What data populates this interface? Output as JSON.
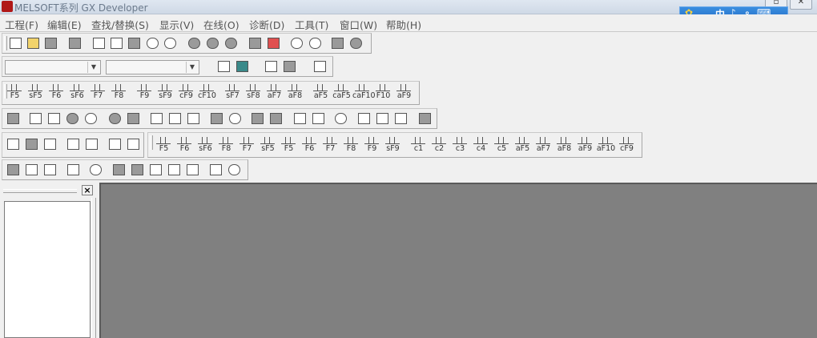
{
  "window": {
    "title": "MELSOFT系列 GX Developer"
  },
  "menu": [
    "工程(F)",
    "编辑(E)",
    "查找/替换(S)",
    "显示(V)",
    "在线(O)",
    "诊断(D)",
    "工具(T)",
    "窗口(W)",
    "帮助(H)"
  ],
  "ime": {
    "glyphs": [
      "中",
      "♪",
      "∘",
      "⌨"
    ]
  },
  "toolbar_standard": {
    "icons": [
      "new-icon",
      "open-icon",
      "save-icon",
      "print-icon",
      "cut-icon",
      "copy-icon",
      "paste-icon",
      "undo-icon",
      "redo-icon",
      "find-device-icon",
      "find-instruction-icon",
      "find-step-icon",
      "write-plc-icon",
      "read-plc-icon",
      "monitor-start-icon",
      "monitor-stop-icon",
      "parameter-icon",
      "comment-icon"
    ]
  },
  "toolbar_ladder_keys": [
    "F5",
    "sF5",
    "F6",
    "sF6",
    "F7",
    "F8",
    "F9",
    "sF9",
    "cF9",
    "cF10",
    "sF7",
    "sF8",
    "aF7",
    "aF8",
    "aF5",
    "caF5",
    "caF10",
    "F10",
    "aF9"
  ],
  "toolbar_sfc_keys": [
    "F5",
    "F6",
    "sF6",
    "F8",
    "F7",
    "sF5",
    "F5",
    "F6",
    "F7",
    "F8",
    "F9",
    "sF9",
    "c1",
    "c2",
    "c3",
    "c4",
    "c5",
    "aF5",
    "aF7",
    "aF8",
    "aF9",
    "aF10",
    "cF9"
  ],
  "panel": {
    "close_label": "×"
  }
}
